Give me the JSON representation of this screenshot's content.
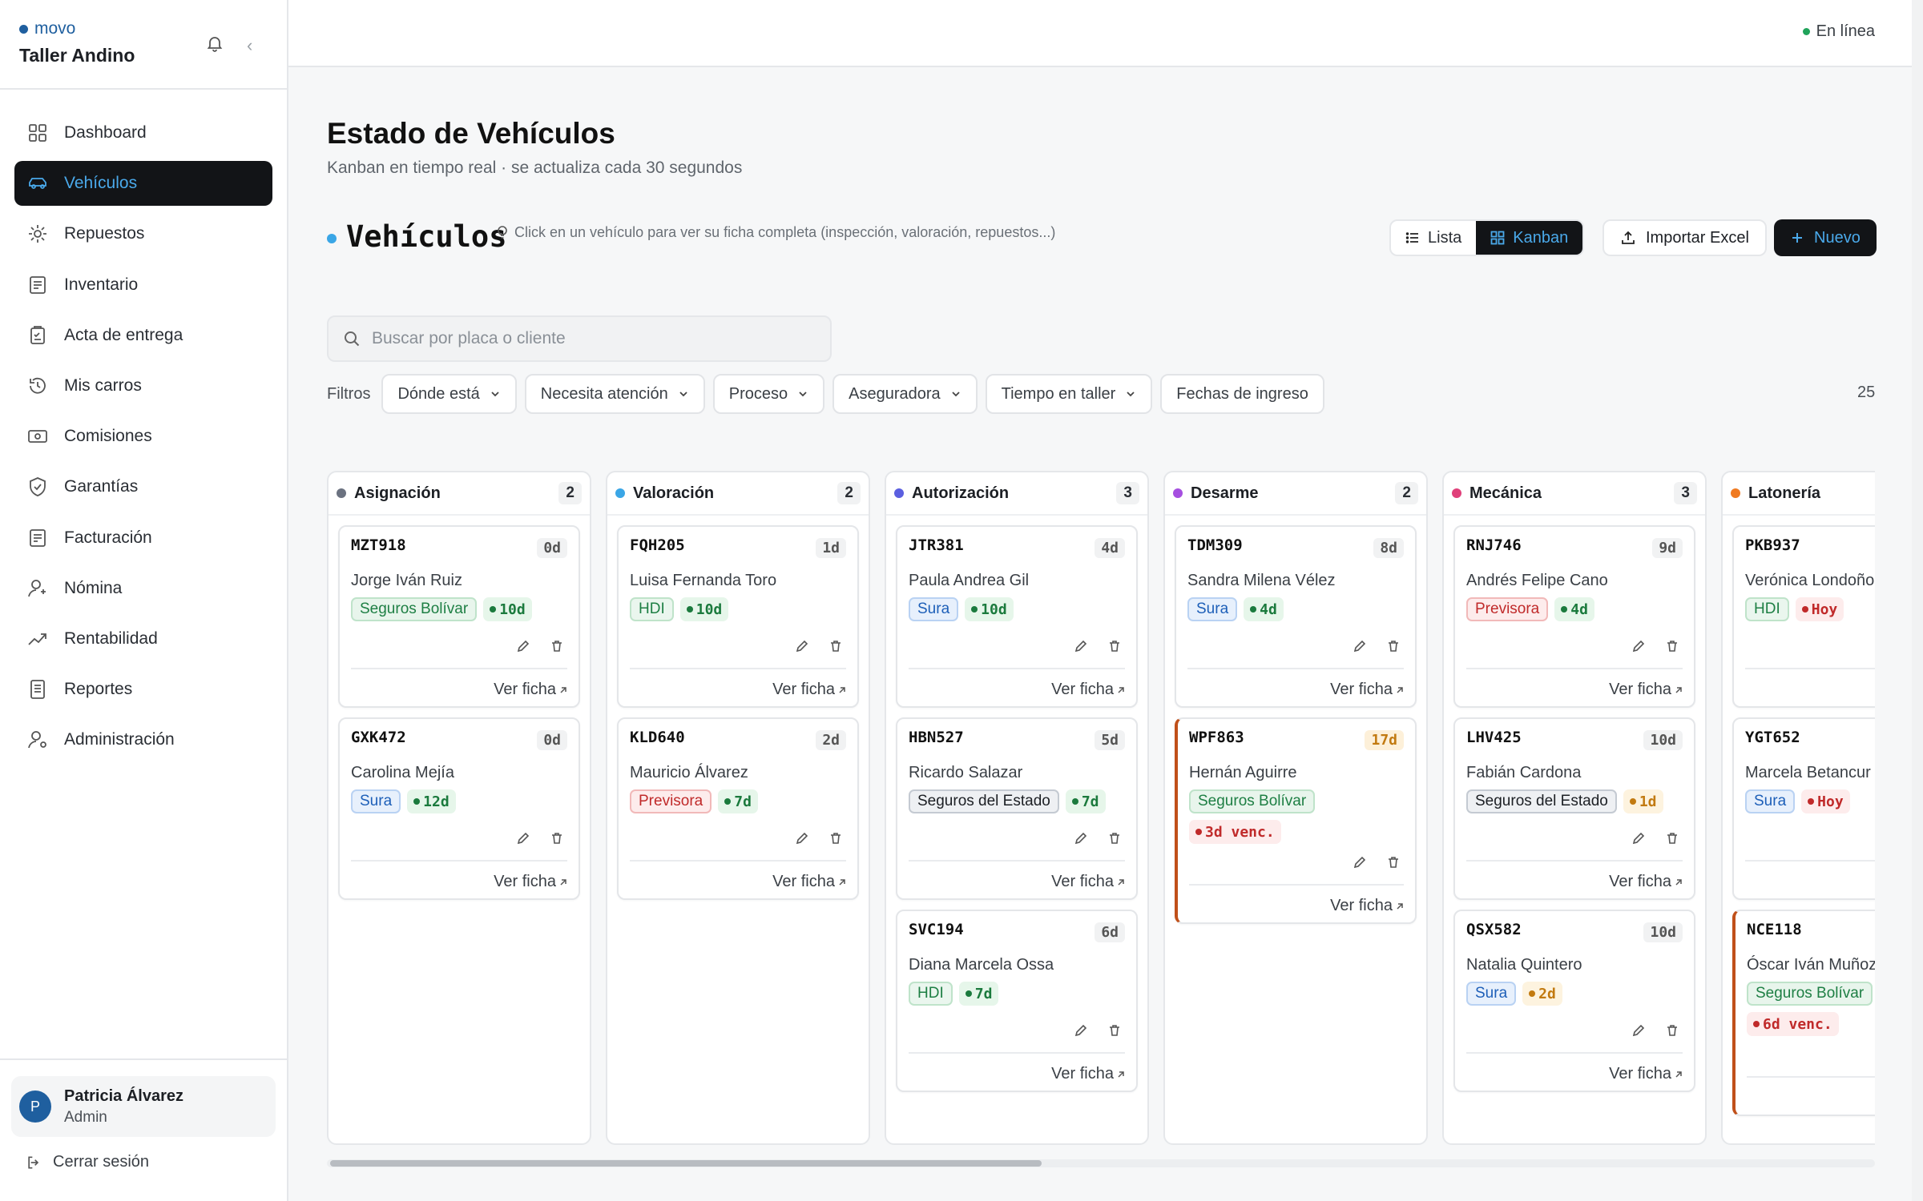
{
  "brand": {
    "mark": "movo",
    "workshop": "Taller Andino"
  },
  "sidebar": {
    "items": [
      {
        "label": "Dashboard",
        "icon": "dashboard-icon"
      },
      {
        "label": "Vehículos",
        "icon": "car-icon",
        "active": true
      },
      {
        "label": "Repuestos",
        "icon": "gear-icon"
      },
      {
        "label": "Inventario",
        "icon": "list-icon"
      },
      {
        "label": "Acta de entrega",
        "icon": "clipboard-icon"
      },
      {
        "label": "Mis carros",
        "icon": "history-icon"
      },
      {
        "label": "Comisiones",
        "icon": "cash-icon"
      },
      {
        "label": "Garantías",
        "icon": "shield-icon"
      },
      {
        "label": "Facturación",
        "icon": "invoice-icon"
      },
      {
        "label": "Nómina",
        "icon": "user-icon"
      },
      {
        "label": "Rentabilidad",
        "icon": "trend-icon"
      },
      {
        "label": "Reportes",
        "icon": "report-icon"
      },
      {
        "label": "Administración",
        "icon": "admin-icon"
      }
    ],
    "user": {
      "initial": "P",
      "name": "Patricia Álvarez",
      "role": "Admin"
    },
    "logout": "Cerrar sesión"
  },
  "topbar": {
    "status": "En línea"
  },
  "page": {
    "title": "Estado de Vehículos",
    "subtitle": "Kanban en tiempo real · se actualiza cada 30 segundos",
    "section_title": "Vehículos",
    "hint": "Click en un vehículo para ver su ficha completa (inspección, valoración, repuestos...)"
  },
  "toolbar": {
    "list": "Lista",
    "kanban": "Kanban",
    "import": "Importar Excel",
    "new": "Nuevo"
  },
  "search": {
    "placeholder": "Buscar por placa o cliente"
  },
  "filters": {
    "label": "Filtros",
    "chips": [
      "Dónde está",
      "Necesita atención",
      "Proceso",
      "Aseguradora",
      "Tiempo en taller",
      "Fechas de ingreso"
    ],
    "count": "25"
  },
  "card_link": "Ver ficha",
  "colors": {
    "accent": "#4aa9ea",
    "dark": "#121417"
  },
  "columns": [
    {
      "title": "Asignación",
      "count": "2",
      "color": "#6b7280",
      "cards": [
        {
          "plate": "MZT918",
          "days": "0d",
          "client": "Jorge Iván Ruiz",
          "insurer": "Seguros Bolívar",
          "ins": "bolivar",
          "sla": "10d",
          "sla_level": "ok"
        },
        {
          "plate": "GXK472",
          "days": "0d",
          "client": "Carolina Mejía",
          "insurer": "Sura",
          "ins": "sura",
          "sla": "12d",
          "sla_level": "ok"
        }
      ]
    },
    {
      "title": "Valoración",
      "count": "2",
      "color": "#3aa6e6",
      "cards": [
        {
          "plate": "FQH205",
          "days": "1d",
          "client": "Luisa Fernanda Toro",
          "insurer": "HDI",
          "ins": "hdi",
          "sla": "10d",
          "sla_level": "ok"
        },
        {
          "plate": "KLD640",
          "days": "2d",
          "client": "Mauricio Álvarez",
          "insurer": "Previsora",
          "ins": "previsora",
          "sla": "7d",
          "sla_level": "ok"
        }
      ]
    },
    {
      "title": "Autorización",
      "count": "3",
      "color": "#5b5fe0",
      "cards": [
        {
          "plate": "JTR381",
          "days": "4d",
          "client": "Paula Andrea Gil",
          "insurer": "Sura",
          "ins": "sura",
          "sla": "10d",
          "sla_level": "ok"
        },
        {
          "plate": "HBN527",
          "days": "5d",
          "client": "Ricardo Salazar",
          "insurer": "Seguros del Estado",
          "ins": "estado",
          "sla": "7d",
          "sla_level": "ok"
        },
        {
          "plate": "SVC194",
          "days": "6d",
          "client": "Diana Marcela Ossa",
          "insurer": "HDI",
          "ins": "hdi",
          "sla": "7d",
          "sla_level": "ok"
        }
      ]
    },
    {
      "title": "Desarme",
      "count": "2",
      "color": "#a64fe0",
      "cards": [
        {
          "plate": "TDM309",
          "days": "8d",
          "client": "Sandra Milena Vélez",
          "insurer": "Sura",
          "ins": "sura",
          "sla": "4d",
          "sla_level": "ok"
        },
        {
          "plate": "WPF863",
          "days": "17d",
          "days_warn": true,
          "client": "Hernán Aguirre",
          "insurer": "Seguros Bolívar",
          "ins": "bolivar",
          "overdue": "3d venc."
        }
      ]
    },
    {
      "title": "Mecánica",
      "count": "3",
      "color": "#e0407a",
      "cards": [
        {
          "plate": "RNJ746",
          "days": "9d",
          "client": "Andrés Felipe Cano",
          "insurer": "Previsora",
          "ins": "previsora",
          "sla": "4d",
          "sla_level": "ok"
        },
        {
          "plate": "LHV425",
          "days": "10d",
          "client": "Fabián Cardona",
          "insurer": "Seguros del Estado",
          "ins": "estado",
          "sla": "1d",
          "sla_level": "warn"
        },
        {
          "plate": "QSX582",
          "days": "10d",
          "client": "Natalia Quintero",
          "insurer": "Sura",
          "ins": "sura",
          "sla": "2d",
          "sla_level": "warn"
        }
      ]
    },
    {
      "title": "Latonería",
      "count": "",
      "color": "#f07a20",
      "cards": [
        {
          "plate": "PKB937",
          "days": "",
          "client": "Verónica Londoño",
          "insurer": "HDI",
          "ins": "hdi",
          "sla": "Hoy",
          "sla_level": "bad"
        },
        {
          "plate": "YGT652",
          "days": "",
          "client": "Marcela Betancur",
          "insurer": "Sura",
          "ins": "sura",
          "sla": "Hoy",
          "sla_level": "bad"
        },
        {
          "plate": "NCE118",
          "days": "",
          "client": "Óscar Iván Muñoz",
          "insurer": "Seguros Bolívar",
          "ins": "bolivar",
          "overdue": "6d venc."
        }
      ]
    }
  ]
}
